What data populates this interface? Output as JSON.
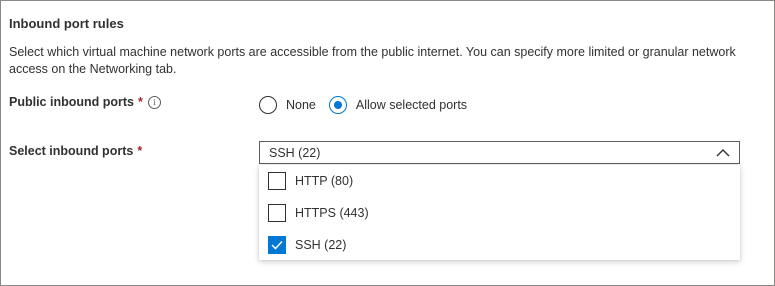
{
  "section": {
    "title": "Inbound port rules",
    "description": "Select which virtual machine network ports are accessible from the public internet. You can specify more limited or granular network access on the Networking tab."
  },
  "public_inbound": {
    "label": "Public inbound ports",
    "required_mark": "*",
    "info_glyph": "i",
    "options": [
      {
        "label": "None",
        "selected": false
      },
      {
        "label": "Allow selected ports",
        "selected": true
      }
    ]
  },
  "select_inbound": {
    "label": "Select inbound ports",
    "required_mark": "*",
    "value": "SSH (22)",
    "expanded": true,
    "options": [
      {
        "label": "HTTP (80)",
        "checked": false
      },
      {
        "label": "HTTPS (443)",
        "checked": false
      },
      {
        "label": "SSH (22)",
        "checked": true
      }
    ]
  },
  "colors": {
    "accent": "#0078d4",
    "required": "#a4262c",
    "text": "#323130",
    "border": "#8a8886"
  }
}
